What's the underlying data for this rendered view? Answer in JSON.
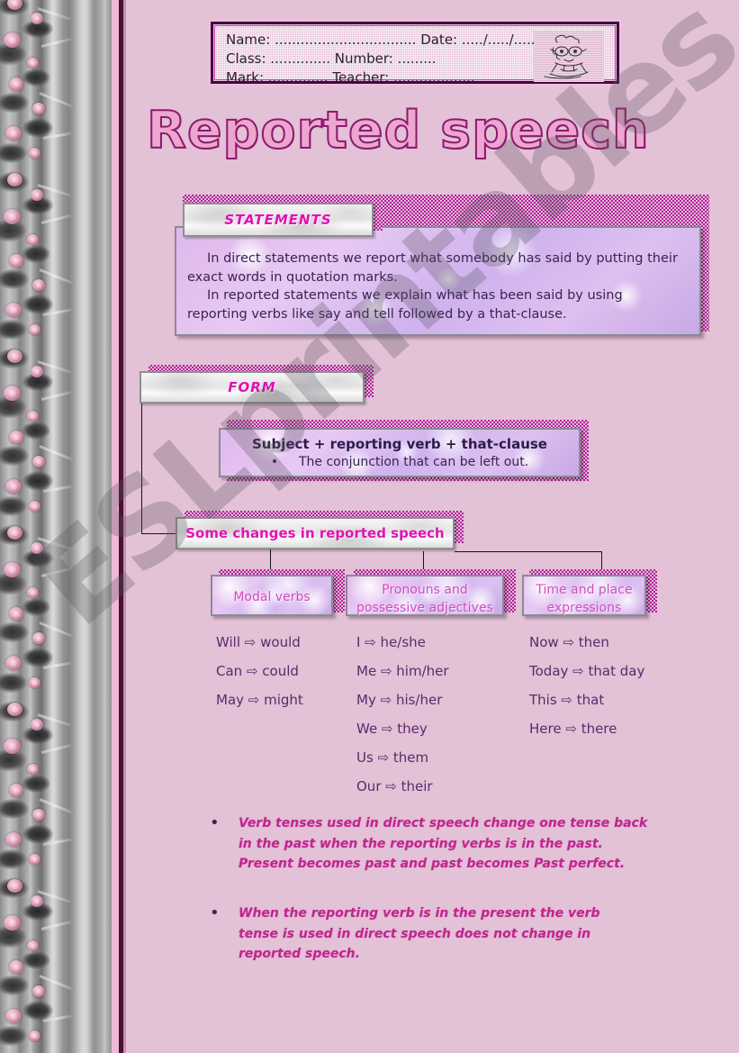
{
  "page": {
    "background_color": "#e3c1d6",
    "accent_magenta": "#e20fb4",
    "accent_purple": "#5b2a6b"
  },
  "watermark": {
    "text": "ESLprintables.com"
  },
  "header": {
    "line1": "Name: ................................. Date: ...../...../.....",
    "line2": "Class: ..............   Number: .........",
    "line3": "Mark: ..............  Teacher: ...................",
    "clipart_name": "cartoon-character-clipart"
  },
  "title": {
    "text": "Reported speech"
  },
  "statements": {
    "label": "STATEMENTS",
    "paragraph1": "In direct statements we report what somebody has said by putting their exact words in quotation marks.",
    "paragraph2": "In reported statements we explain what has been said by using reporting verbs like say and tell followed by a that-clause."
  },
  "form": {
    "label": "FORM",
    "formula": "Subject + reporting verb + that-clause",
    "note": "The conjunction that can be left out.",
    "note_bullet": "•"
  },
  "changes": {
    "label": "Some changes in reported speech",
    "columns": [
      {
        "title": "Modal verbs",
        "title_lines": [
          "Modal verbs"
        ],
        "pairs": [
          {
            "from": "Will",
            "arrow": "⇨",
            "to": "would"
          },
          {
            "from": "Can",
            "arrow": "⇨",
            "to": "could"
          },
          {
            "from": "May",
            "arrow": "⇨",
            "to": "might"
          }
        ]
      },
      {
        "title": "Pronouns and possessive adjectives",
        "title_lines": [
          "Pronouns and",
          "possessive adjectives"
        ],
        "pairs": [
          {
            "from": "I",
            "arrow": "⇨",
            "to": "he/she"
          },
          {
            "from": "Me",
            "arrow": "⇨",
            "to": "him/her"
          },
          {
            "from": "My",
            "arrow": "⇨",
            "to": "his/her"
          },
          {
            "from": "We",
            "arrow": "⇨",
            "to": "they"
          },
          {
            "from": "Us",
            "arrow": "⇨",
            "to": "them"
          },
          {
            "from": "Our",
            "arrow": "⇨",
            "to": "their"
          }
        ]
      },
      {
        "title": "Time and place expressions",
        "title_lines": [
          "Time and place",
          "expressions"
        ],
        "pairs": [
          {
            "from": "Now",
            "arrow": "⇨",
            "to": "then"
          },
          {
            "from": "Today",
            "arrow": "⇨",
            "to": "that day"
          },
          {
            "from": "This",
            "arrow": "⇨",
            "to": "that"
          },
          {
            "from": "Here",
            "arrow": "⇨",
            "to": "there"
          }
        ]
      }
    ]
  },
  "notes": {
    "bullet_char": "•",
    "items": [
      "Verb tenses used in direct speech change one tense back in the past when the reporting verbs is in the past. Present becomes past and past becomes Past perfect.",
      "When the reporting verb is in the present the verb tense is used in direct speech does not change in reported speech."
    ]
  }
}
